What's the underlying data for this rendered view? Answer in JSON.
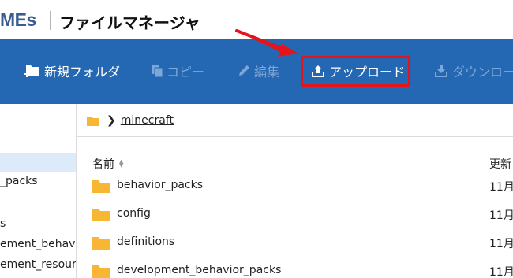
{
  "header": {
    "logo_text": "MEs",
    "title": "ファイルマネージャ"
  },
  "toolbar": {
    "new_folder": "新規フォルダ",
    "copy": "コピー",
    "edit": "編集",
    "upload": "アップロード",
    "download": "ダウンロー"
  },
  "sidebar": {
    "items": [
      "_packs",
      "s",
      "ement_behavior",
      "ement_resource"
    ]
  },
  "breadcrumb": {
    "path": "minecraft"
  },
  "table": {
    "headers": {
      "name": "名前",
      "updated": "更新"
    },
    "rows": [
      {
        "name": "behavior_packs",
        "date": "11月"
      },
      {
        "name": "config",
        "date": "11月"
      },
      {
        "name": "definitions",
        "date": "11月"
      },
      {
        "name": "development_behavior_packs",
        "date": "11月"
      }
    ]
  },
  "colors": {
    "toolbar_bg": "#2468b4",
    "highlight": "#e3141b",
    "folder": "#f7b733",
    "sidebar_selected": "#dceafa"
  },
  "icons": {
    "new_folder": "folder-plus-icon",
    "copy": "copy-icon",
    "edit": "pencil-icon",
    "upload": "upload-icon",
    "download": "download-icon",
    "folder": "folder-icon",
    "breadcrumb_sep": "chevron-right-icon",
    "sort": "sort-icon"
  }
}
